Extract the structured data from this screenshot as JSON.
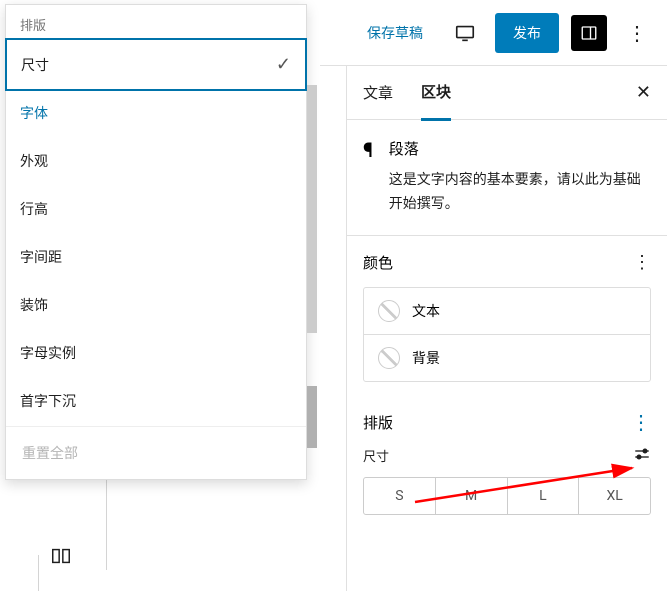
{
  "dropdown": {
    "header": "排版",
    "items": [
      {
        "label": "尺寸",
        "selected": true
      },
      {
        "label": "字体",
        "blue": true
      },
      {
        "label": "外观"
      },
      {
        "label": "行高"
      },
      {
        "label": "字间距"
      },
      {
        "label": "装饰"
      },
      {
        "label": "字母实例"
      },
      {
        "label": "首字下沉"
      }
    ],
    "reset": "重置全部"
  },
  "topbar": {
    "save_draft": "保存草稿",
    "publish": "发布"
  },
  "tabs": {
    "post": "文章",
    "block": "区块"
  },
  "block": {
    "icon": "¶",
    "title": "段落",
    "desc": "这是文字内容的基本要素，请以此为基础开始撰写。"
  },
  "color": {
    "title": "颜色",
    "text": "文本",
    "bg": "背景"
  },
  "typo": {
    "title": "排版",
    "size_label": "尺寸",
    "sizes": [
      "S",
      "M",
      "L",
      "XL"
    ]
  }
}
